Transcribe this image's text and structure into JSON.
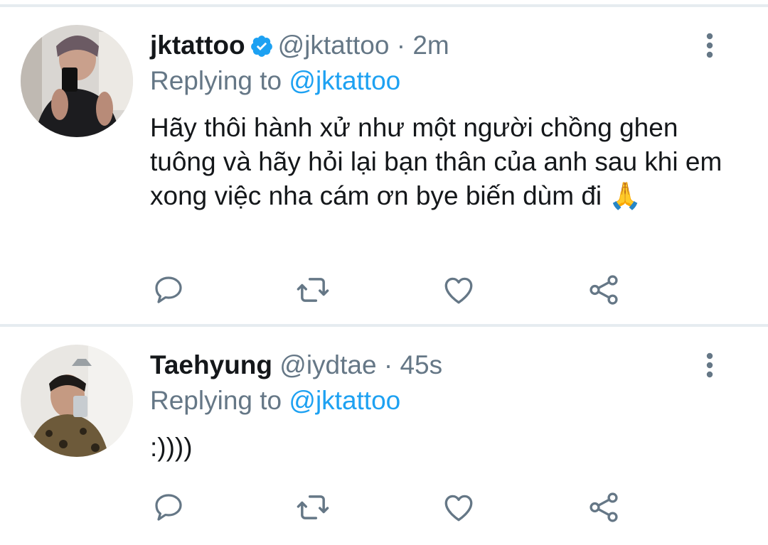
{
  "tweets": [
    {
      "name": "jktattoo",
      "verified": true,
      "handle": "@jktattoo",
      "dot": "·",
      "time": "2m",
      "replying_prefix": "Replying to",
      "replying_mention": "@jktattoo",
      "text": "Hãy thôi hành xử như một người chồng ghen tuông và hãy hỏi lại bạn thân của anh sau khi em xong việc nha cám ơn bye biến dùm đi 🙏"
    },
    {
      "name": "Taehyung",
      "verified": false,
      "handle": "@iydtae",
      "dot": "·",
      "time": "45s",
      "replying_prefix": "Replying to",
      "replying_mention": "@jktattoo",
      "text": ":))))"
    }
  ],
  "colors": {
    "icon": "#657786",
    "mention": "#1da1f2",
    "verified": "#1da1f2",
    "separator": "#e6ecf0"
  },
  "icons": [
    "reply-icon",
    "retweet-icon",
    "like-icon",
    "share-icon",
    "more-icon",
    "verified-icon"
  ]
}
